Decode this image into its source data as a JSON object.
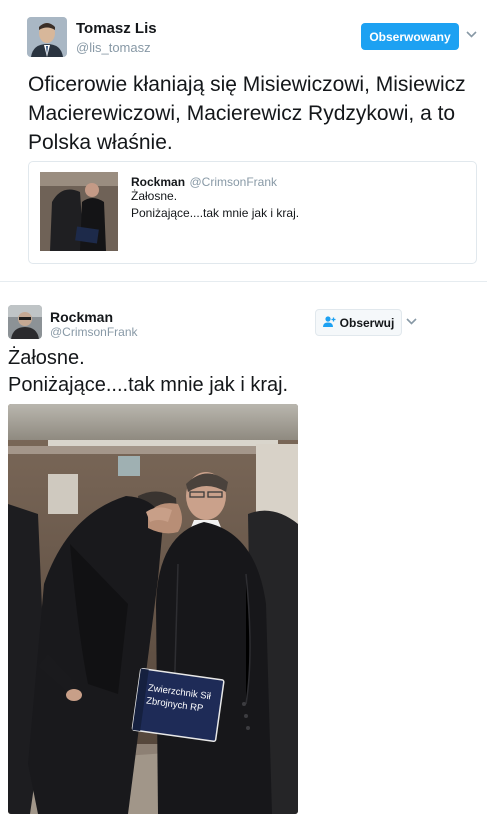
{
  "tweet_main": {
    "author_name": "Tomasz Lis",
    "author_handle": "@lis_tomasz",
    "follow_label": "Obserwowany",
    "text_lines": [
      "Oficerowie kłaniają się Misiewiczowi, Misiewicz",
      "Macierewiczowi, Macierewicz Rydzykowi, a to",
      "Polska właśnie."
    ],
    "quoted": {
      "author_name": "Rockman",
      "author_handle": "@CrimsonFrank",
      "text_lines": [
        "Żałosne.",
        "Poniżające....tak mnie jak i kraj."
      ]
    }
  },
  "tweet_second": {
    "author_name": "Rockman",
    "author_handle": "@CrimsonFrank",
    "follow_label": "Obserwuj",
    "text_lines": [
      "Żałosne.",
      "Poniżające....tak mnie jak i kraj."
    ],
    "photo": {
      "sign_line_1": "Zwierzchnik Sił",
      "sign_line_2": "Zbrojnych RP"
    }
  },
  "icons": {
    "chevron": "chevron-down-icon",
    "follow_person": "person-add-icon"
  },
  "colors": {
    "accent": "#1da1f2",
    "handle_gray": "#8899a6",
    "border": "#e1e8ed"
  }
}
